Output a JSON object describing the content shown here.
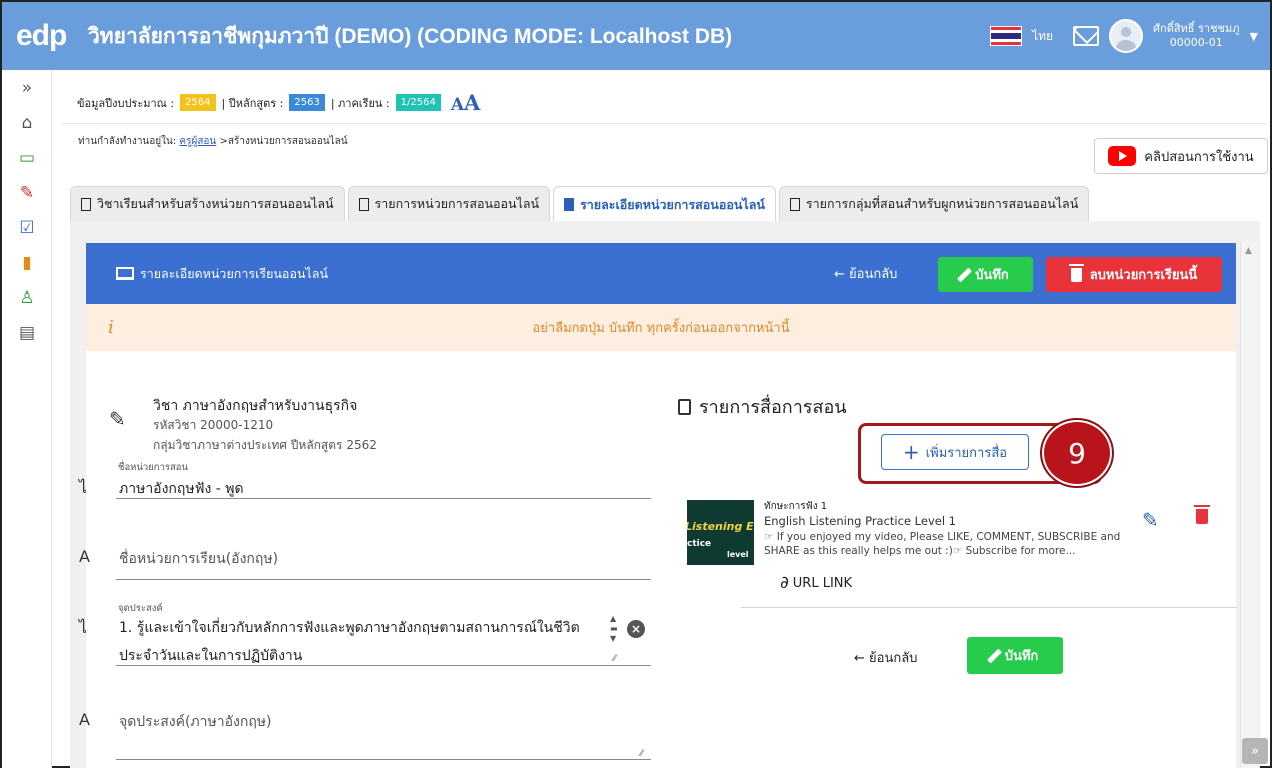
{
  "header": {
    "logo_text": "edp",
    "title": "วิทยาลัยการอาชีพกุมภวาปี (DEMO) (CODING MODE: Localhost DB)",
    "lang_label": "ไทย",
    "user_name": "ศักดิ์สิทธิ์ ราชชมภู",
    "user_id": "00000-01",
    "flag_colors": [
      "#e8313d",
      "#ffffff",
      "#2d2a7c",
      "#ffffff",
      "#e8313d"
    ]
  },
  "sidebar": {
    "icons": [
      {
        "name": "expand-icon",
        "glyph": "»",
        "color": "#555555"
      },
      {
        "name": "home-icon",
        "glyph": "⌂",
        "color": "#555555"
      },
      {
        "name": "monitor-icon",
        "glyph": "▭",
        "color": "#2aa036"
      },
      {
        "name": "pencil-icon",
        "glyph": "✎",
        "color": "#d0302f"
      },
      {
        "name": "checkbox-icon",
        "glyph": "☑",
        "color": "#3b6fd1"
      },
      {
        "name": "books-icon",
        "glyph": "▮",
        "color": "#e38a1b"
      },
      {
        "name": "person-icon",
        "glyph": "♙",
        "color": "#2aa036"
      },
      {
        "name": "archive-icon",
        "glyph": "▤",
        "color": "#555555"
      }
    ]
  },
  "info": {
    "budget_label": "ข้อมูลปีงบประมาณ :",
    "budget_value": "2564",
    "curriculum_label": "| ปีหลักสูตร :",
    "curriculum_value": "2563",
    "semester_label": "| ภาคเรียน :",
    "semester_value": "1/2564",
    "font_small": "A",
    "font_large": "A",
    "chip_colors": {
      "budget": "#f5c21b",
      "curriculum": "#3b8ad9",
      "semester": "#1fc3b4"
    }
  },
  "breadcrumb": {
    "prefix": "ท่านกำลังทำงานอยู่ใน:",
    "link": "ครูผู้สอน",
    "current": ">สร้างหน่วยการสอนออนไลน์"
  },
  "help_button": "คลิปสอนการใช้งาน",
  "tabs": [
    {
      "label": "วิชาเรียนสำหรับสร้างหน่วยการสอนออนไลน์",
      "active": false
    },
    {
      "label": "รายการหน่วยการสอนออนไลน์",
      "active": false
    },
    {
      "label": "รายละเอียดหน่วยการสอนออนไลน์",
      "active": true
    },
    {
      "label": "รายการกลุ่มที่สอนสำหรับผูกหน่วยการสอนออนไลน์",
      "active": false
    }
  ],
  "bluebar": {
    "title": "รายละเอียดหน่วยการเรียนออนไลน์",
    "back": "← ย้อนกลับ",
    "save": "บันทึก",
    "delete": "ลบหน่วยการเรียนนี้"
  },
  "warning": {
    "icon": "i",
    "text": "อย่าลืมกดปุ่ม บันทึก ทุกครั้งก่อนออกจากหน้านี้"
  },
  "subject": {
    "title": "วิชา ภาษาอังกฤษสำหรับงานธุรกิจ",
    "code": "รหัสวิชา 20000-1210",
    "group": "กลุ่มวิชาภาษาต่างประเทศ ปีหลักสูตร 2562"
  },
  "form": {
    "unit_name_label": "ชื่อหน่วยการสอน",
    "unit_name_value": "ภาษาอังกฤษฟัง - พูด",
    "unit_name_en_placeholder": "ชื่อหน่วยการเรียน(อังกฤษ)",
    "purpose_label": "จุดประสงค์",
    "purpose_value": "1. รู้และเข้าใจเกี่ยวกับหลักการฟังและพูดภาษาอังกฤษตามสถานการณ์ในชีวิตประจำวันและในการปฏิบัติงาน",
    "purpose_en_placeholder": "จุดประสงค์(ภาษาอังกฤษ)",
    "thai_prefix": "ไ",
    "en_prefix": "A"
  },
  "media": {
    "section_title": "รายการสื่อการสอน",
    "add_button": "เพิ่มรายการสื่อ",
    "step_badge": "9",
    "item": {
      "name": "ทักษะการฟัง 1",
      "title_en": "English Listening Practice Level 1",
      "description": "☞ If you enjoyed my video, Please LIKE, COMMENT, SUBSCRIBE and SHARE as this really helps me out :)☞ Subscribe for more...",
      "thumb_line1": "Listening Eng",
      "thumb_line2": "ctice",
      "thumb_line3": "level",
      "url_link": "URL LINK"
    },
    "back": "← ย้อนกลับ",
    "save": "บันทึก"
  },
  "colors": {
    "header_bg": "#6a9ddb",
    "primary_blue": "#3b6fd1",
    "save_green": "#28cc4c",
    "delete_red": "#e8333a",
    "warn_bg": "#fdeee0",
    "callout_red": "#b9141b"
  }
}
